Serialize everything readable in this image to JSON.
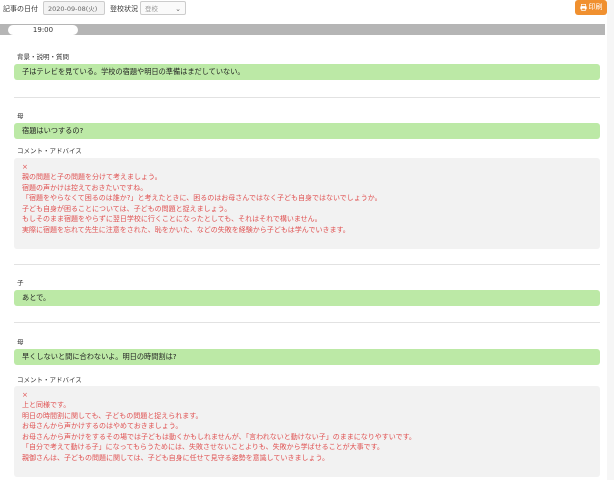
{
  "toolbar": {
    "date_label": "記事の日付",
    "date_value": "2020-09-08(火)",
    "status_label": "登校状況",
    "status_value": "登校",
    "print_label": "印刷"
  },
  "timeline": {
    "time": "19:00"
  },
  "sections": {
    "s1_label": "背景・説明・質問",
    "s1_text": "子はテレビを見ている。学校の宿題や明日の準備はまだしていない。",
    "s2_label": "母",
    "s2_text": "宿題はいつするの?",
    "s2_advice_label": "コメント・アドバイス",
    "s2_mark": "×",
    "s2_advice": [
      "親の問題と子の問題を分けて考えましょう。",
      "宿題の声かけは控えておきたいですね。",
      "「宿題をやらなくて困るのは誰か?」と考えたときに、困るのはお母さんではなく子ども自身ではないでしょうか。",
      "子ども自身が困ることについては、子どもの問題と捉えましょう。",
      "もしそのまま宿題をやらずに翌日学校に行くことになったとしても、それはそれで構いません。",
      "実際に宿題を忘れて先生に注意をされた、恥をかいた、などの失敗を経験から子どもは学んでいきます。"
    ],
    "s3_label": "子",
    "s3_text": "あとで。",
    "s4_label": "母",
    "s4_text": "早くしないと間に合わないよ。明日の時間割は?",
    "s4_advice_label": "コメント・アドバイス",
    "s4_mark": "×",
    "s4_advice": [
      "上と同様です。",
      "明日の時間割に関しても、子どもの問題と捉えられます。",
      "お母さんから声かけするのはやめておきましょう。",
      "お母さんから声かけをするその場では子どもは動くかもしれませんが、「言われないと動けない子」のままになりやすいです。",
      "「自分で考えて動ける子」になってもらうためには、失敗させないことよりも、失敗から学ばせることが大事です。",
      "親御さんは、子どもの問題に関しては、子ども自身に任せて見守る姿勢を意識していきましょう。"
    ]
  }
}
